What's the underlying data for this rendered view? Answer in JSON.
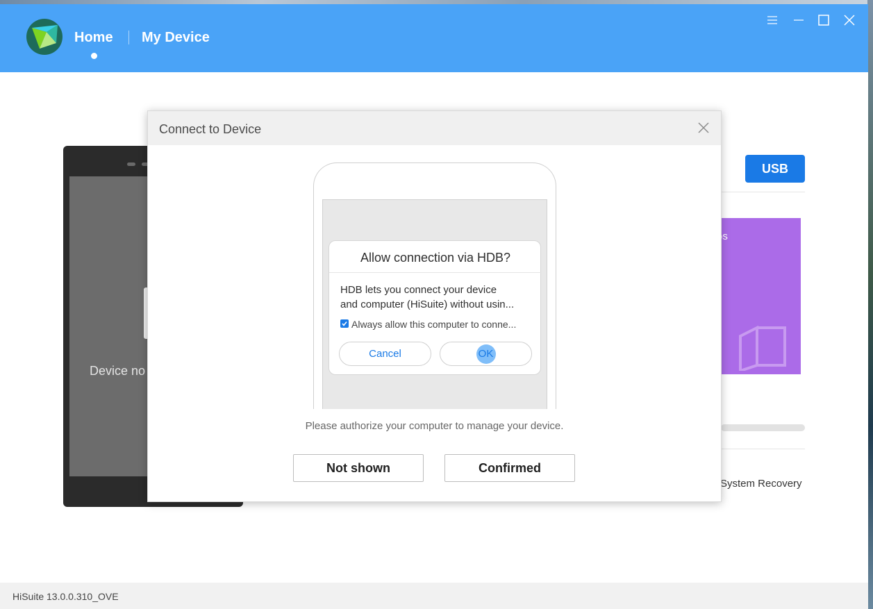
{
  "header": {
    "nav_home": "Home",
    "nav_my_device": "My Device",
    "logo_icon": "hisuite-logo-icon",
    "window_controls": [
      "menu-icon",
      "minimize-icon",
      "maximize-icon",
      "close-icon"
    ]
  },
  "background": {
    "device_status": "Device no",
    "usb_label": "USB",
    "card_text": "os",
    "system_recovery": "System Recovery"
  },
  "modal": {
    "title": "Connect to Device",
    "instruction": "Please authorize your computer to manage your device.",
    "not_shown_label": "Not shown",
    "confirmed_label": "Confirmed",
    "hdb_dialog": {
      "title": "Allow connection via HDB?",
      "body_line1": "HDB lets you connect your device",
      "body_line2": "and computer (HiSuite) without usin...",
      "checkbox_label": "Always allow this computer to conne...",
      "cancel_label": "Cancel",
      "ok_label": "OK"
    }
  },
  "statusbar": {
    "version": "HiSuite 13.0.0.310_OVE"
  },
  "colors": {
    "titlebar": "#4aa3f7",
    "accent": "#1a7ae6",
    "card": "#ab6be8"
  }
}
